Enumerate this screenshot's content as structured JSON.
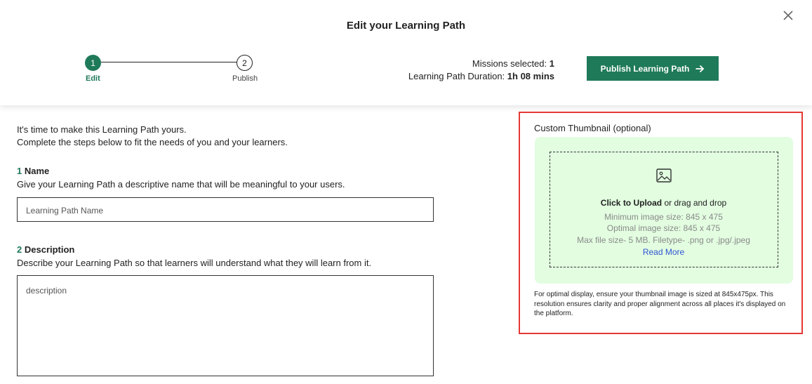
{
  "header": {
    "title": "Edit your Learning Path",
    "steps": [
      {
        "number": "1",
        "label": "Edit"
      },
      {
        "number": "2",
        "label": "Publish"
      }
    ],
    "missions_label": "Missions selected:",
    "missions_value": "1",
    "duration_label": "Learning Path Duration:",
    "duration_value": "1h 08 mins",
    "publish_label": "Publish Learning Path"
  },
  "intro": {
    "line1": "It's time to make this Learning Path yours.",
    "line2": "Complete the steps below to fit the needs of you and your learners."
  },
  "name_section": {
    "number": "1",
    "title": "Name",
    "description": "Give your Learning Path a descriptive name that will be meaningful to your users.",
    "placeholder": "Learning Path Name",
    "value": ""
  },
  "description_section": {
    "number": "2",
    "title": "Description",
    "description": "Describe your Learning Path so that learners will understand what they will learn from it.",
    "placeholder": "description",
    "value": ""
  },
  "thumbnail": {
    "title": "Custom Thumbnail (optional)",
    "upload_label": "Click to Upload",
    "drag_text": " or drag and drop",
    "min_size": "Minimum image size: 845 x 475",
    "optimal_size": "Optimal image size: 845 x 475",
    "file_info": "Max file size- 5 MB. Filetype- .png or .jpg/.jpeg",
    "read_more": "Read More",
    "note": "For optimal display, ensure your thumbnail image is sized at 845x475px. This resolution ensures clarity and proper alignment across all places it's displayed on the platform."
  },
  "colors": {
    "accent": "#1f7a5a",
    "drop_bg": "#e2fde0",
    "highlight_border": "#e53935",
    "link": "#2f55d4"
  },
  "icons": [
    "close-icon",
    "arrow-right-icon",
    "image-icon"
  ]
}
